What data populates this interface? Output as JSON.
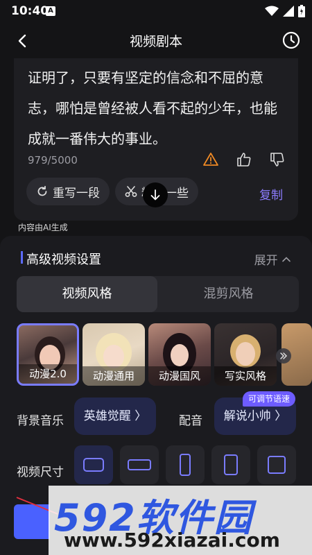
{
  "status_bar": {
    "time": "10:40",
    "notification_glyph": "A"
  },
  "app_bar": {
    "title": "视频剧本"
  },
  "script": {
    "lines": [
      "证明了，只要有坚定的信念和不屈的意",
      "志，哪怕是曾经被人看不起的少年，也能",
      "成就一番伟大的事业。"
    ],
    "word_count": "979/5000",
    "actions": {
      "rewrite": "重写一段",
      "refine": "精简一些",
      "copy": "复制"
    }
  },
  "ai_generated_notice": "内容由AI生成",
  "settings": {
    "title": "高级视频设置",
    "expand": "展开",
    "style_tabs": [
      "视频风格",
      "混剪风格"
    ],
    "styles": [
      "动漫2.0",
      "动漫通用",
      "动漫国风",
      "写实风格"
    ],
    "music_label": "背景音乐",
    "music_value": "英雄觉醒 〉",
    "voice_label": "配音",
    "voice_value": "解说小帅 〉",
    "voice_badge": "可调节语速",
    "size_label": "视频尺寸"
  },
  "watermark": {
    "brand": "592软件园",
    "url": "www.592xiazai.com"
  },
  "colors": {
    "accent": "#6d5cff",
    "link": "#8c7cff",
    "warning": "#f08a24",
    "selection": "#7a7cff"
  }
}
